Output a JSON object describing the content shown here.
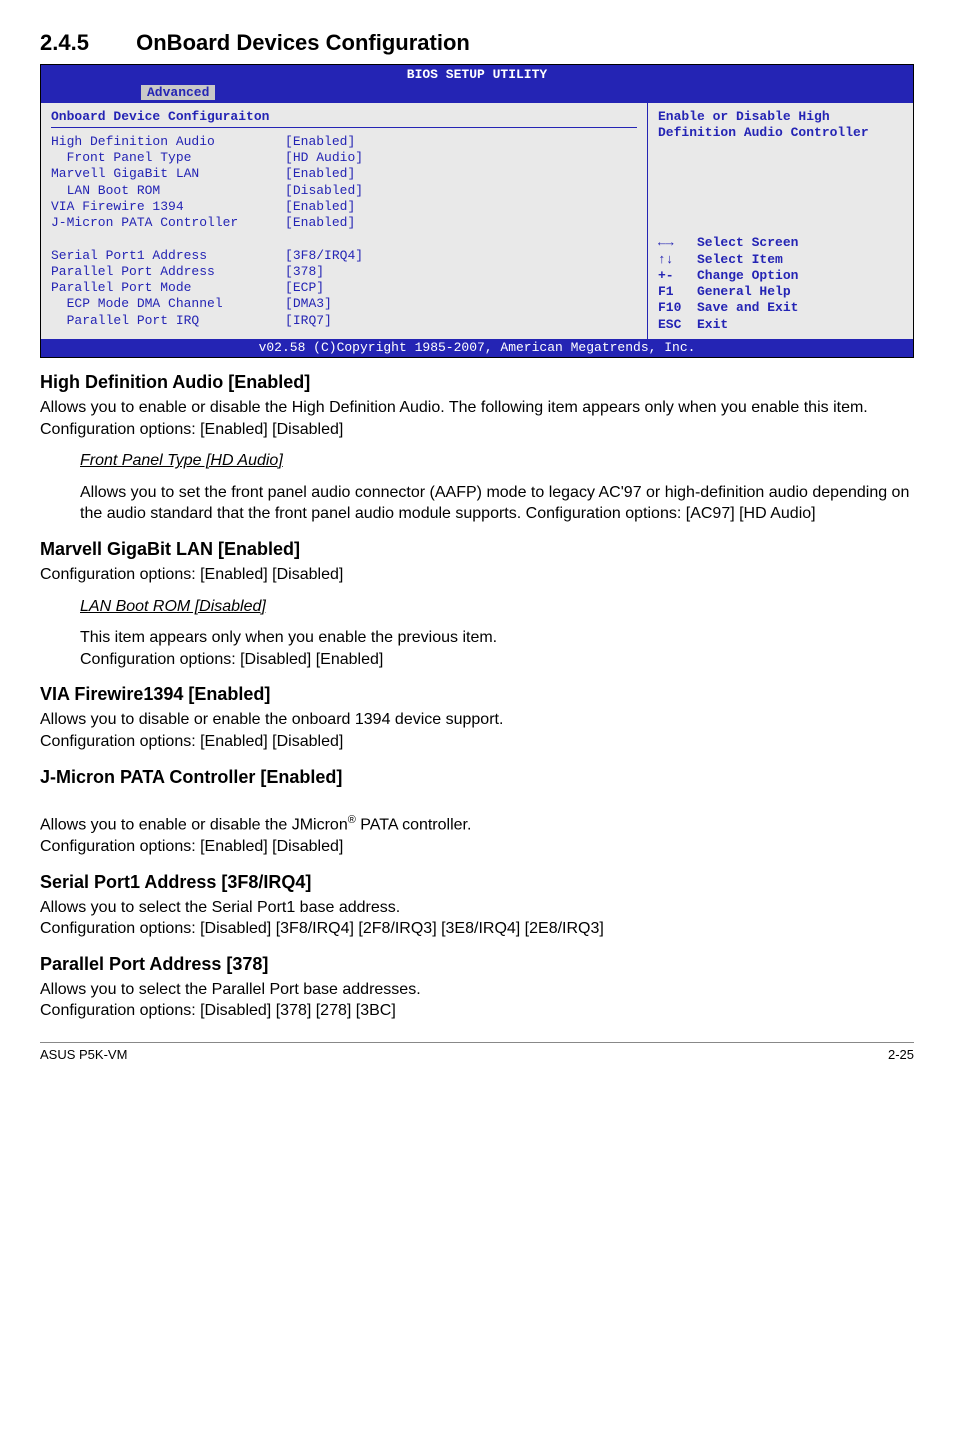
{
  "section": {
    "number": "2.4.5",
    "title": "OnBoard Devices Configuration"
  },
  "bios": {
    "title": "BIOS SETUP UTILITY",
    "tab": "Advanced",
    "heading": "Onboard Device Configuraiton",
    "rows": [
      {
        "label": "High Definition Audio",
        "value": "[Enabled]",
        "indent": 0
      },
      {
        "label": "Front Panel Type",
        "value": "[HD Audio]",
        "indent": 1
      },
      {
        "label": "Marvell GigaBit LAN",
        "value": "[Enabled]",
        "indent": 0
      },
      {
        "label": "LAN Boot ROM",
        "value": "[Disabled]",
        "indent": 1
      },
      {
        "label": "VIA Firewire 1394",
        "value": "[Enabled]",
        "indent": 0
      },
      {
        "label": "J-Micron PATA Controller",
        "value": "[Enabled]",
        "indent": 0
      },
      {
        "label": "",
        "value": "",
        "indent": 0
      },
      {
        "label": "Serial Port1 Address",
        "value": "[3F8/IRQ4]",
        "indent": 0
      },
      {
        "label": "Parallel Port Address",
        "value": "[378]",
        "indent": 0
      },
      {
        "label": "Parallel Port Mode",
        "value": "[ECP]",
        "indent": 0
      },
      {
        "label": "ECP Mode DMA Channel",
        "value": "[DMA3]",
        "indent": 1
      },
      {
        "label": "Parallel Port IRQ",
        "value": "[IRQ7]",
        "indent": 1
      }
    ],
    "help_top": "Enable or Disable High Definition Audio Controller",
    "help_keys": [
      {
        "k": "←→",
        "d": "Select Screen"
      },
      {
        "k": "↑↓",
        "d": "Select Item"
      },
      {
        "k": "+-",
        "d": "Change Option"
      },
      {
        "k": "F1",
        "d": "General Help"
      },
      {
        "k": "F10",
        "d": "Save and Exit"
      },
      {
        "k": "ESC",
        "d": "Exit"
      }
    ],
    "foot": "v02.58 (C)Copyright 1985-2007, American Megatrends, Inc."
  },
  "content": {
    "hda_h": "High Definition Audio [Enabled]",
    "hda_p": "Allows you to enable or disable the High Definition Audio. The following item appears only when you enable this item.\nConfiguration options: [Enabled] [Disabled]",
    "fpt_t": "Front Panel Type [HD Audio]",
    "fpt_p": "Allows you to set the front panel audio connector (AAFP) mode to legacy AC'97 or high-definition audio depending on the audio standard that the front panel audio module supports. Configuration options: [AC97] [HD Audio]",
    "lan_h": "Marvell GigaBit LAN [Enabled]",
    "lan_p": "Configuration options: [Enabled] [Disabled]",
    "lboot_t": "LAN Boot ROM [Disabled]",
    "lboot_p": "This item appears only when you enable the previous item.\nConfiguration options: [Disabled] [Enabled]",
    "via_h": "VIA Firewire1394 [Enabled]",
    "via_p": "Allows you to disable or enable the onboard 1394 device support.\nConfiguration options: [Enabled] [Disabled]",
    "jm_h": "J-Micron PATA Controller [Enabled]",
    "jm_p1": "Allows you to enable or disable the JMicron",
    "jm_sup": "®",
    "jm_p2": " PATA controller.\nConfiguration options: [Enabled] [Disabled]",
    "sp_h": "Serial Port1 Address [3F8/IRQ4]",
    "sp_p": "Allows you to select the Serial Port1 base address.\nConfiguration options: [Disabled] [3F8/IRQ4] [2F8/IRQ3] [3E8/IRQ4] [2E8/IRQ3]",
    "pp_h": "Parallel Port Address [378]",
    "pp_p": "Allows you to select the Parallel Port base addresses.\nConfiguration options: [Disabled] [378] [278] [3BC]"
  },
  "footer": {
    "left": "ASUS P5K-VM",
    "right": "2-25"
  }
}
